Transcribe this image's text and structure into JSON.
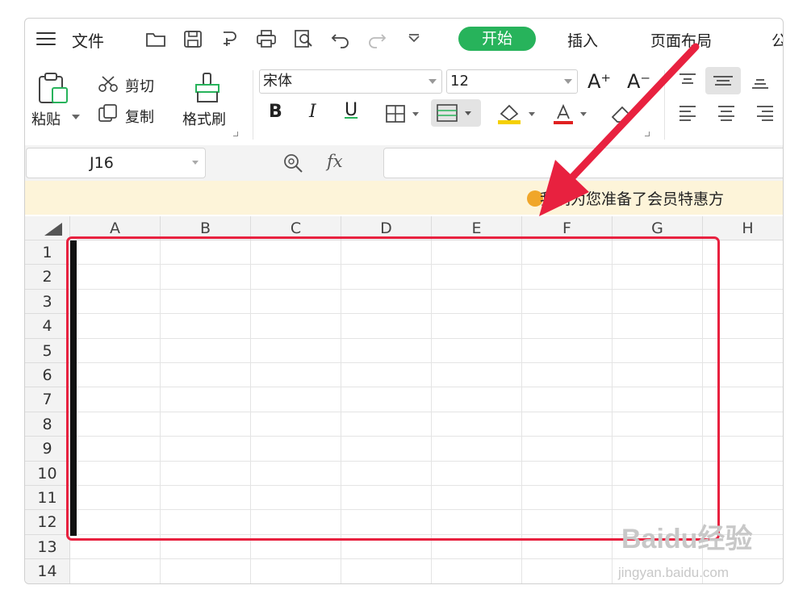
{
  "menubar": {
    "file_label": "文件",
    "tabs": {
      "start": "开始",
      "insert": "插入",
      "page_layout": "页面布局",
      "formula_partial": "公"
    }
  },
  "ribbon": {
    "paste": "粘贴",
    "cut": "剪切",
    "copy": "复制",
    "format_painter": "格式刷",
    "font_name": "宋体",
    "font_size": "12",
    "increase_font": "A⁺",
    "decrease_font": "A⁻",
    "bold": "B",
    "italic": "I",
    "underline": "U"
  },
  "formula_bar": {
    "name_box": "J16",
    "fx": "fx"
  },
  "notice": {
    "text": "我们为您准备了会员特惠方"
  },
  "grid": {
    "columns": [
      "A",
      "B",
      "C",
      "D",
      "E",
      "F",
      "G",
      "H"
    ],
    "rows": [
      "1",
      "2",
      "3",
      "4",
      "5",
      "6",
      "7",
      "8",
      "9",
      "10",
      "11",
      "12",
      "13",
      "14"
    ],
    "bordered_range": "A1:G12"
  },
  "annotation": {
    "outline_color": "#e8213f",
    "arrow_color": "#e8213f"
  },
  "watermark": {
    "brand": "Baidu经验",
    "url": "jingyan.baidu.com"
  },
  "colors": {
    "accent": "#27b35b",
    "notice_bg": "#fdf4d9"
  }
}
